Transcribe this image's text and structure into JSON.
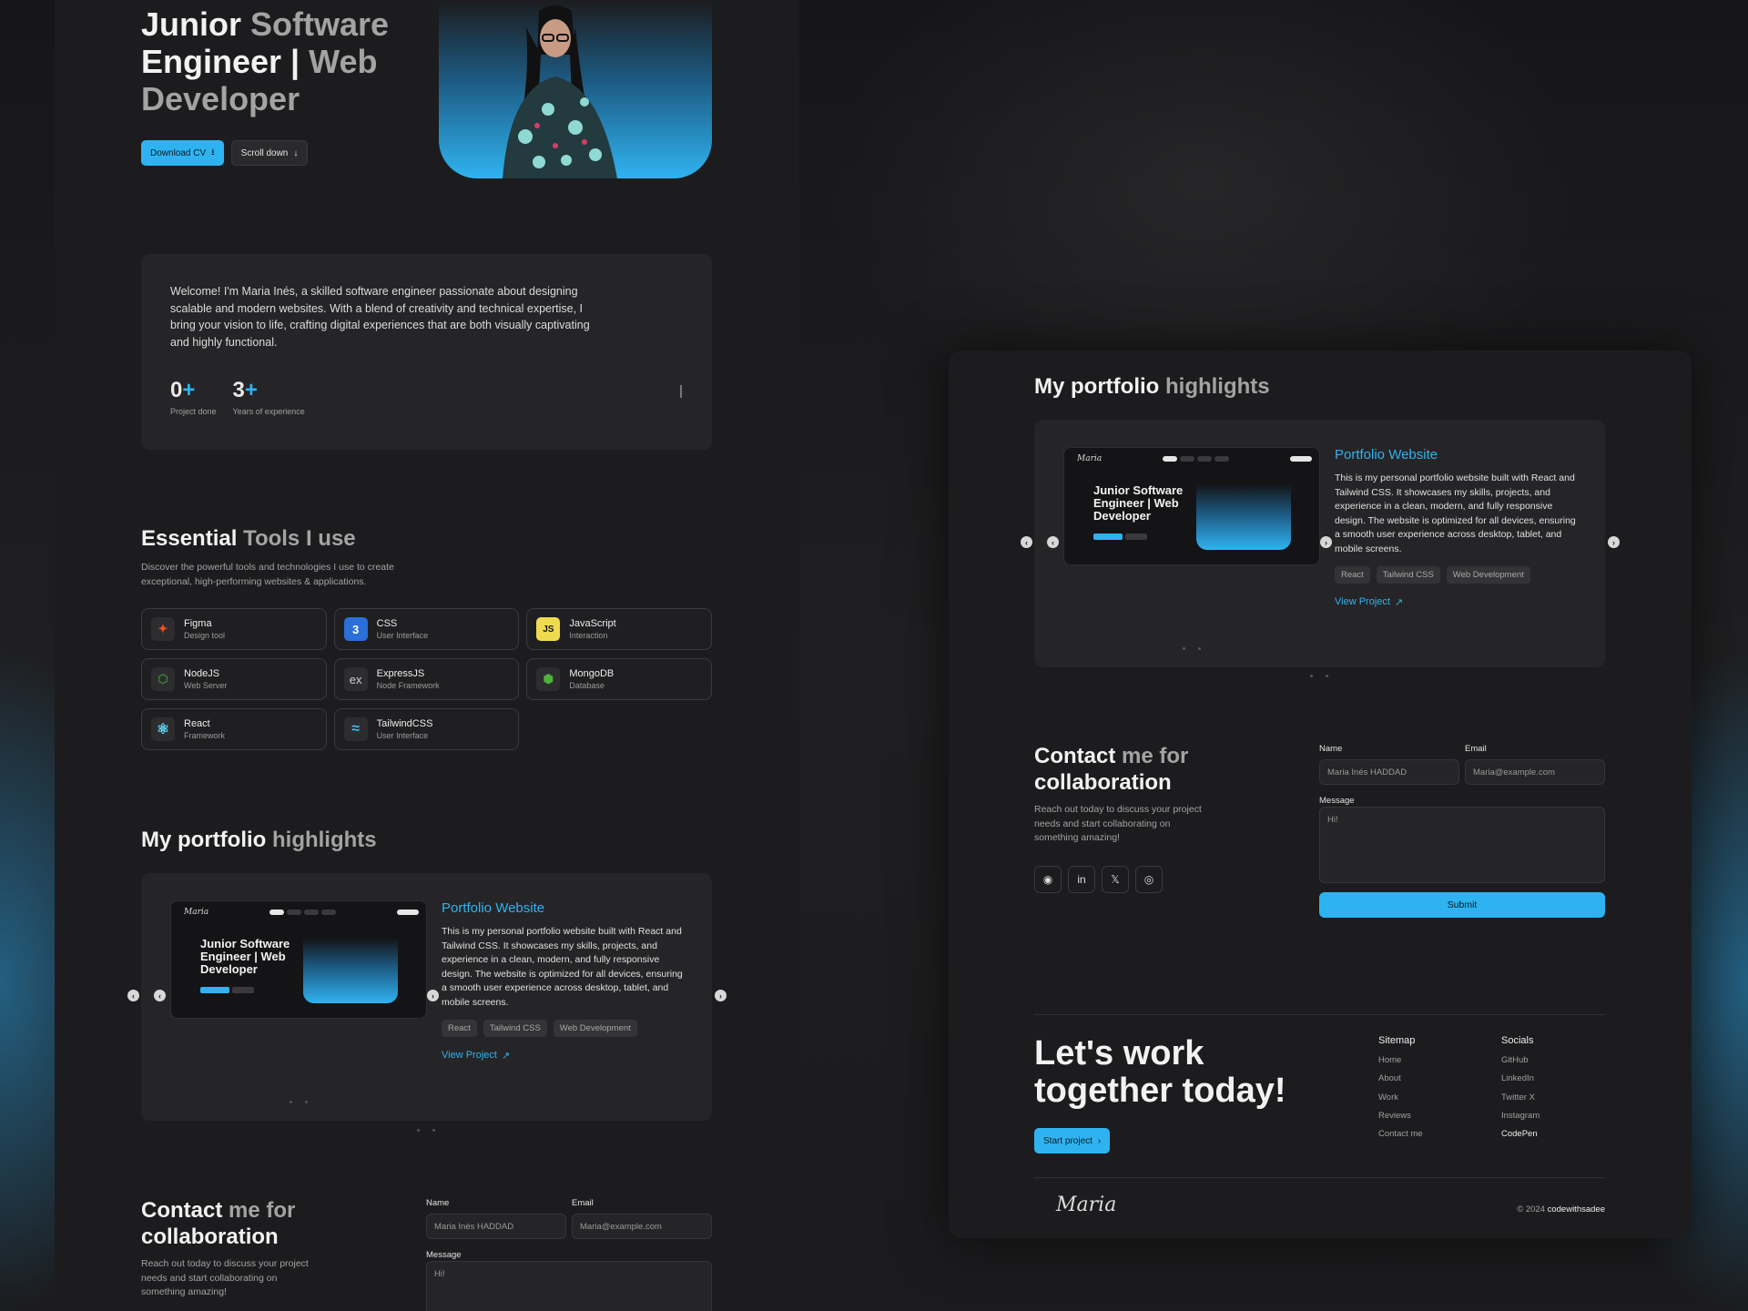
{
  "hero": {
    "title_white": "Junior",
    "title_grey1": "Software",
    "title_white2": "Engineer |",
    "title_grey2": "Web Developer",
    "download_cv": "Download CV",
    "scroll_down": "Scroll down"
  },
  "intro": {
    "text": "Welcome! I'm Maria Inés, a skilled software engineer passionate about designing scalable and modern websites. With a blend of creativity and technical expertise, I bring your vision to life, crafting digital experiences that are both visually captivating and highly functional.",
    "stats": [
      {
        "num": "0",
        "plus": "+",
        "label": "Project done"
      },
      {
        "num": "3",
        "plus": "+",
        "label": "Years of experience"
      }
    ]
  },
  "tools": {
    "title_white": "Essential",
    "title_grey": "Tools I use",
    "desc": "Discover the powerful tools and technologies I use to create exceptional, high-performing websites & applications.",
    "items": [
      {
        "name": "Figma",
        "sub": "Design tool",
        "glyph": "✦",
        "color": "#f24e1e"
      },
      {
        "name": "CSS",
        "sub": "User Interface",
        "glyph": "3",
        "color": "#2b9be8"
      },
      {
        "name": "JavaScript",
        "sub": "Interaction",
        "glyph": "JS",
        "color": "#f0db4f"
      },
      {
        "name": "NodeJS",
        "sub": "Web Server",
        "glyph": "⬡",
        "color": "#3c873a"
      },
      {
        "name": "ExpressJS",
        "sub": "Node Framework",
        "glyph": "ex",
        "color": "#cfcfcf"
      },
      {
        "name": "MongoDB",
        "sub": "Database",
        "glyph": "⬢",
        "color": "#4db33d"
      },
      {
        "name": "React",
        "sub": "Framework",
        "glyph": "⚛",
        "color": "#61dafb"
      },
      {
        "name": "TailwindCSS",
        "sub": "User Interface",
        "glyph": "≈",
        "color": "#38bdf8"
      }
    ]
  },
  "portfolio": {
    "title_white": "My portfolio",
    "title_grey": "highlights",
    "project_title": "Portfolio Website",
    "project_desc": "This is my personal portfolio website built with React and Tailwind CSS. It showcases my skills, projects, and experience in a clean, modern, and fully responsive design. The website is optimized for all devices, ensuring a smooth user experience across desktop, tablet, and mobile screens.",
    "tags": [
      "React",
      "Tailwind CSS",
      "Web Development"
    ],
    "view_project": "View Project",
    "shot_title": "Junior Software Engineer | Web Developer"
  },
  "contact": {
    "title_white": "Contact",
    "title_grey": "me for",
    "title_white2": "collaboration",
    "desc": "Reach out today to discuss your project needs and start collaborating on something amazing!",
    "name_label": "Name",
    "name_value": "Maria Inés HADDAD",
    "email_label": "Email",
    "email_value": "Maria@example.com",
    "message_label": "Message",
    "message_value": "Hi!",
    "submit": "Submit"
  },
  "footer": {
    "cta": "Let's work together today!",
    "start_project": "Start project",
    "sitemap_title": "Sitemap",
    "sitemap": [
      "Home",
      "About",
      "Work",
      "Reviews",
      "Contact me"
    ],
    "socials_title": "Socials",
    "socials": [
      "GitHub",
      "LinkedIn",
      "Twitter X",
      "Instagram",
      "CodePen"
    ],
    "signature": "Maria",
    "copyright": "© 2024",
    "author": "codewithsadee"
  }
}
